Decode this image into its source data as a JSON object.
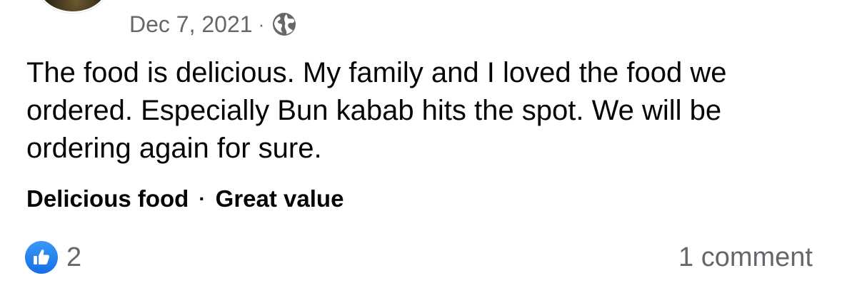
{
  "post": {
    "date": "Dec 7, 2021",
    "separator": "·",
    "audience_icon": "globe-icon",
    "text": "The food is delicious. My family and I loved the food we ordered. Especially Bun kabab hits the spot. We will be ordering again for sure."
  },
  "tags": {
    "items": [
      "Delicious food",
      "Great value"
    ],
    "separator": "·"
  },
  "reactions": {
    "icon": "like-icon",
    "count": "2",
    "color": "#1877f2"
  },
  "comments": {
    "label": "1 comment"
  }
}
